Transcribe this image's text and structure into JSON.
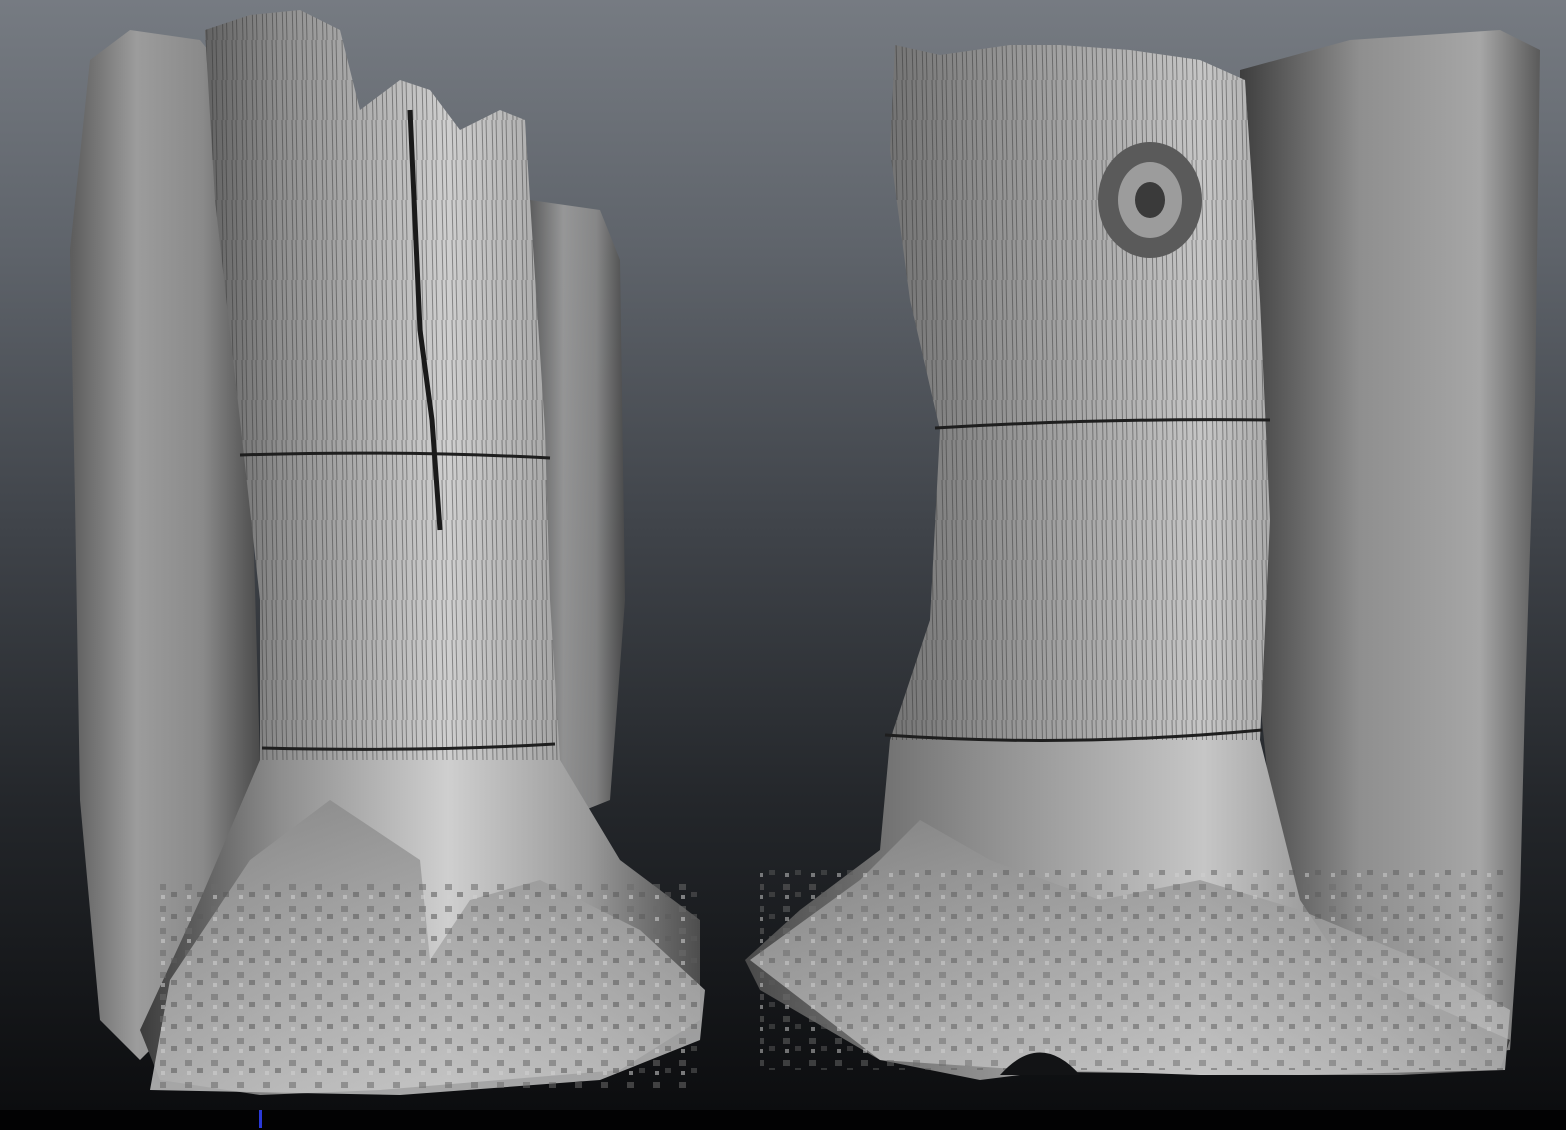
{
  "scene": {
    "background_gradient": [
      "#767b82",
      "#3f4349",
      "#0c0d0f"
    ],
    "model_color": "#9a9a9a",
    "cursor_marker_color": "#2a39d8"
  },
  "models": [
    {
      "name": "tree-stump-model-front-view"
    },
    {
      "name": "tree-stump-model-side-view"
    }
  ]
}
